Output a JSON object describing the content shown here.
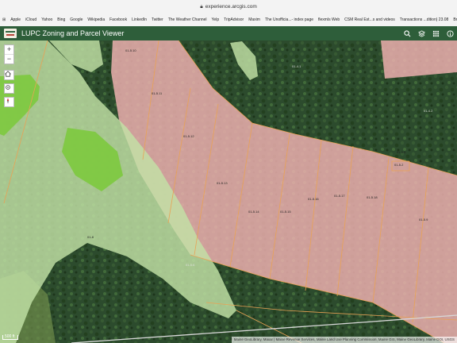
{
  "browser": {
    "url": "experience.arcgis.com",
    "bookmarks": [
      "Apple",
      "iCloud",
      "Yahoo",
      "Bing",
      "Google",
      "Wikipedia",
      "Facebook",
      "LinkedIn",
      "Twitter",
      "The Weather Channel",
      "Yelp",
      "TripAdvisor",
      "Maxim",
      "The Unofficia...- index page",
      "flexmls Web",
      "CSM Real Est...s and videos",
      "Transactions ...dition) 23.08",
      "Breaking"
    ]
  },
  "app": {
    "title": "LUPC Zoning and Parcel Viewer",
    "header_icons": [
      "search-icon",
      "layers-icon",
      "grid-icon",
      "info-icon"
    ]
  },
  "map": {
    "colors": {
      "imagery": "#2b4a2c",
      "protection_zone_light": "#c2e2a6",
      "protection_zone_bright": "#7dc93e",
      "development_zone": "#f3b3b3",
      "parcel_line": "#e9a255"
    },
    "parcel_labels": [
      "01-5.10",
      "01-5.11",
      "01-5.12",
      "01-5.13",
      "01-5.14",
      "01-5.15",
      "01-5.16",
      "01-5.17",
      "01-5.18",
      "01-5.9",
      "01-5.2",
      "01-5.6",
      "01-4.1",
      "01-4.2",
      "01-8",
      "01-5.6"
    ],
    "controls": [
      "zoom-in",
      "zoom-out",
      "home",
      "locate",
      "compass"
    ],
    "scale": "500 ft",
    "attribution": "Maine GeoLibrary, Maxar | Maine Revenue Services, Maine Land Use Planning Commission, Maine GIS, Maine GeoLibrary, Maine DOI, USGS"
  }
}
